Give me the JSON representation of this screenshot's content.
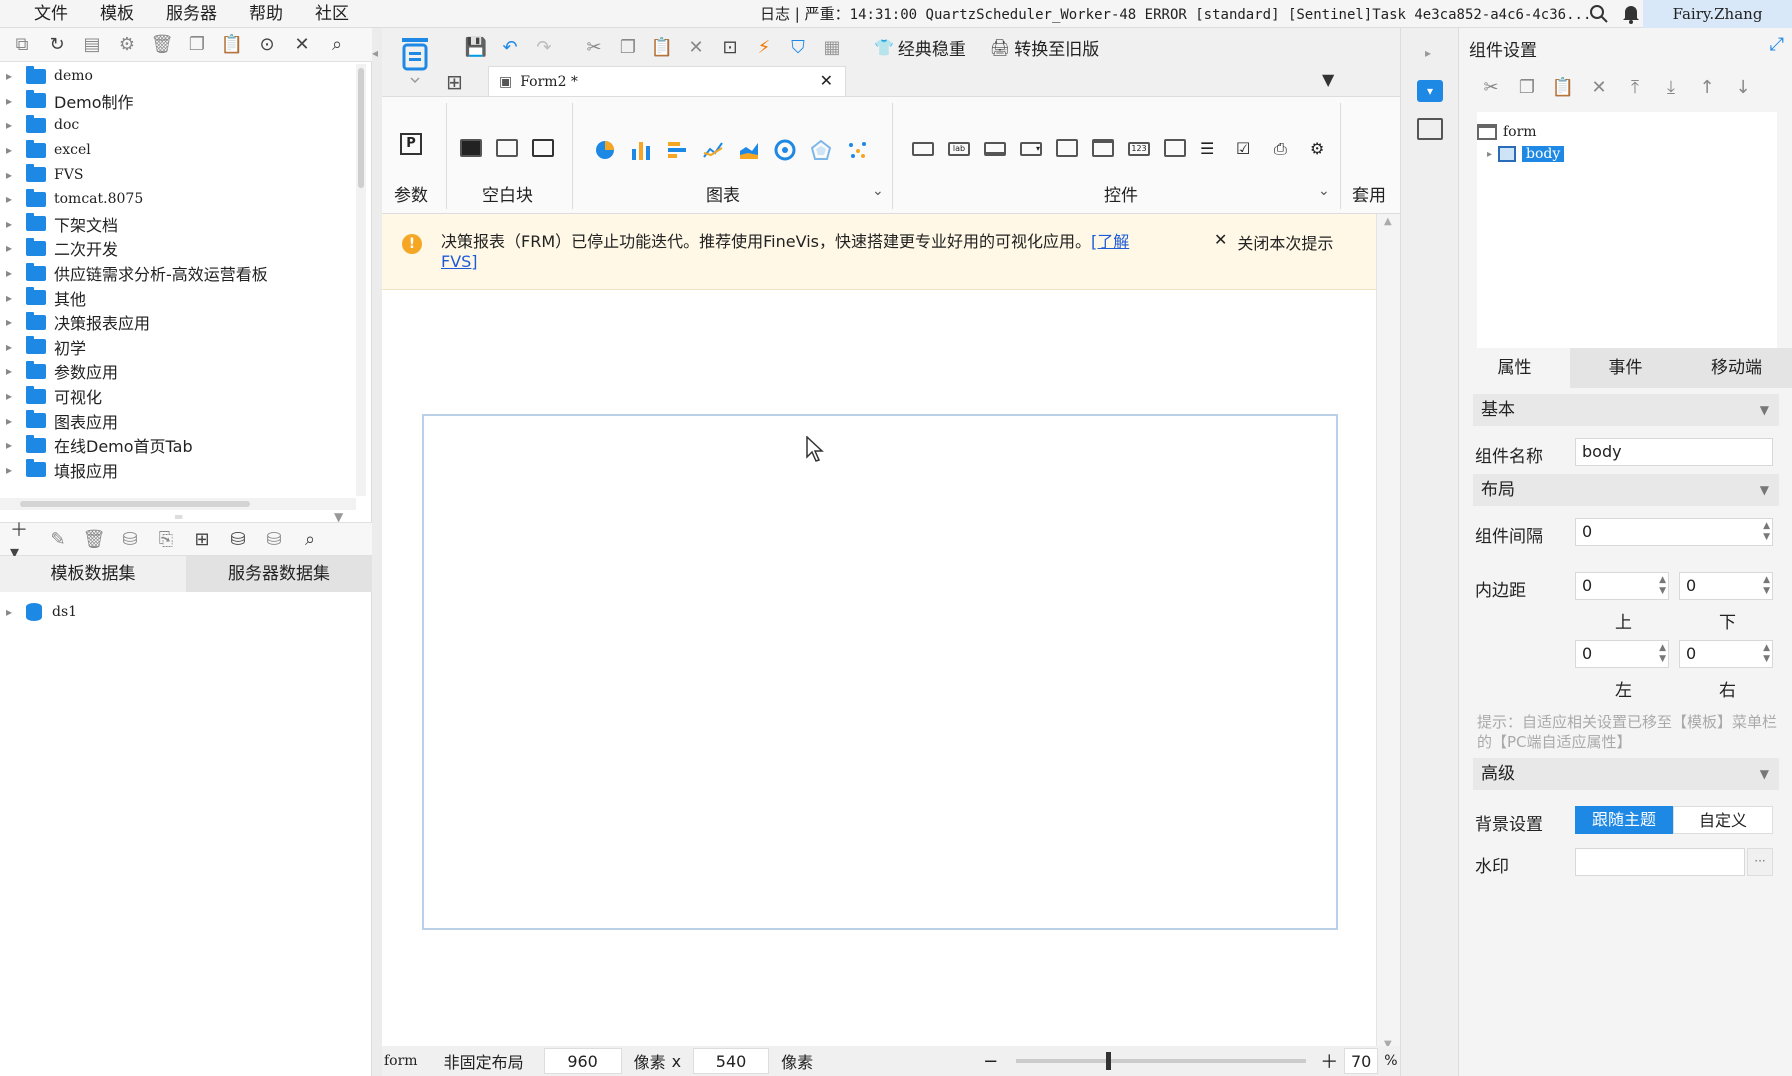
{
  "menu": {
    "items": [
      "文件",
      "模板",
      "服务器",
      "帮助",
      "社区"
    ]
  },
  "log": {
    "label": "日志",
    "severity": "严重",
    "message": "14:31:00 QuartzScheduler_Worker-48 ERROR [standard] [Sentinel]Task 4e3ca852-a4c6-4c36..."
  },
  "user": {
    "name": "Fairy.Zhang"
  },
  "tree": {
    "items": [
      {
        "label": "demo",
        "mono": true
      },
      {
        "label": "Demo制作",
        "mono": false
      },
      {
        "label": "doc",
        "mono": true
      },
      {
        "label": "excel",
        "mono": true
      },
      {
        "label": "FVS",
        "mono": true
      },
      {
        "label": "tomcat.8075",
        "mono": true
      },
      {
        "label": "下架文档",
        "mono": false
      },
      {
        "label": "二次开发",
        "mono": false
      },
      {
        "label": "供应链需求分析-高效运营看板",
        "mono": false
      },
      {
        "label": "其他",
        "mono": false
      },
      {
        "label": "决策报表应用",
        "mono": false
      },
      {
        "label": "初学",
        "mono": false
      },
      {
        "label": "参数应用",
        "mono": false
      },
      {
        "label": "可视化",
        "mono": false
      },
      {
        "label": "图表应用",
        "mono": false
      },
      {
        "label": "在线Demo首页Tab",
        "mono": false
      },
      {
        "label": "填报应用",
        "mono": false
      }
    ]
  },
  "dataset": {
    "tabs": [
      "模板数据集",
      "服务器数据集"
    ],
    "items": [
      "ds1"
    ]
  },
  "toolbar": {
    "classic_label": "经典稳重",
    "convert_label": "转换至旧版"
  },
  "file_tab": {
    "title": "Form2 *"
  },
  "ribbon": {
    "groups": [
      "参数",
      "空白块",
      "图表",
      "控件",
      "套用"
    ]
  },
  "notice": {
    "text": "决策报表（FRM）已停止功能迭代。推荐使用FineVis，快速搭建更专业好用的可视化应用。",
    "link": "[了解FVS]",
    "close_label": "关闭本次提示"
  },
  "status": {
    "form_label": "form",
    "layout_label": "非固定布局",
    "width": "960",
    "unit1": "像素",
    "x_sep": "x",
    "height": "540",
    "unit2": "像素",
    "zoom": "70",
    "zoom_unit": "%"
  },
  "right_panel": {
    "title": "组件设置",
    "tree_root": "form",
    "tree_child": "body",
    "tabs": [
      "属性",
      "事件",
      "移动端"
    ],
    "sections": {
      "basic": "基本",
      "layout": "布局",
      "advanced": "高级"
    },
    "component_name_label": "组件名称",
    "component_name_value": "body",
    "gap_label": "组件间隔",
    "gap_value": "0",
    "padding_label": "内边距",
    "padding_top": "0",
    "padding_bottom": "0",
    "padding_left": "0",
    "padding_right": "0",
    "top_label": "上",
    "bottom_label": "下",
    "left_label": "左",
    "right_label": "右",
    "hint": "提示：自适应相关设置已移至【模板】菜单栏的【PC端自适应属性】",
    "bg_label": "背景设置",
    "bg_options": [
      "跟随主题",
      "自定义"
    ],
    "watermark_label": "水印",
    "watermark_value": ""
  },
  "colors": {
    "accent": "#1e88e5",
    "notice_bg": "#fff8e6",
    "notice_icon": "#f5a623",
    "link": "#1e5bd6"
  }
}
